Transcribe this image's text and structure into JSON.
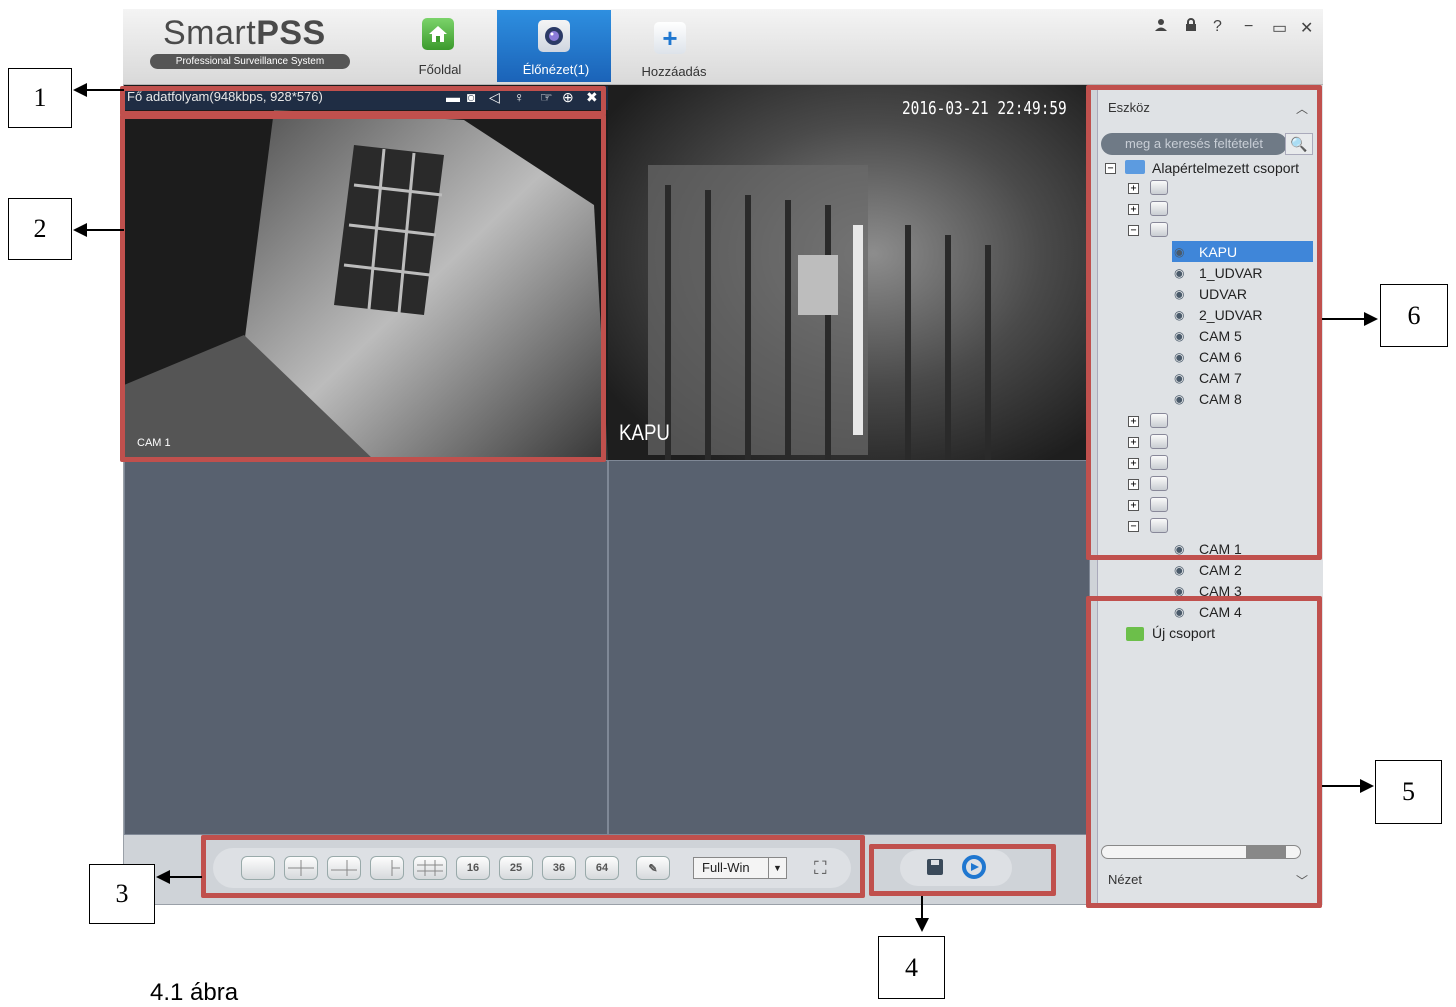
{
  "header": {
    "logo_main_light": "Smart",
    "logo_main_bold": "PSS",
    "logo_sub": "Professional Surveillance System",
    "tabs": [
      {
        "label": "Főoldal",
        "icon": "home-icon"
      },
      {
        "label": "Élőnézet(1)",
        "icon": "camera-lens-icon"
      },
      {
        "label": "Hozzáadás",
        "icon": "plus-icon"
      }
    ],
    "window_controls": [
      "user-icon",
      "lock-icon",
      "help-icon",
      "minimize-icon",
      "maximize-icon",
      "close-icon"
    ]
  },
  "video": {
    "stream_info": "Fő adatfolyam(948kbps, 928*576)",
    "pane1_label": "CAM 1",
    "pane2_timestamp": "2016-03-21 22:49:59",
    "pane2_label": "KAPU"
  },
  "toolbar": {
    "layouts": [
      "",
      "",
      "",
      "",
      "",
      "16",
      "25",
      "36",
      "64"
    ],
    "fullwin": "Full-Win"
  },
  "panel": {
    "title": "Eszköz",
    "search_placeholder": "meg a keresés feltételét",
    "group_name": "Alapértelmezett csoport",
    "cams_group3": [
      "KAPU",
      "1_UDVAR",
      "UDVAR",
      "2_UDVAR",
      "CAM 5",
      "CAM 6",
      "CAM 7",
      "CAM 8"
    ],
    "cams_group9": [
      "CAM 1",
      "CAM 2",
      "CAM 3",
      "CAM 4"
    ],
    "new_group": "Új csoport",
    "bottom_title": "Nézet"
  },
  "callouts": [
    "1",
    "2",
    "3",
    "4",
    "5",
    "6"
  ],
  "caption": "4.1 ábra",
  "colors": {
    "annotation_red": "#c0504d",
    "selection_blue": "#3f86d9",
    "active_tab": "#1b63b8"
  }
}
